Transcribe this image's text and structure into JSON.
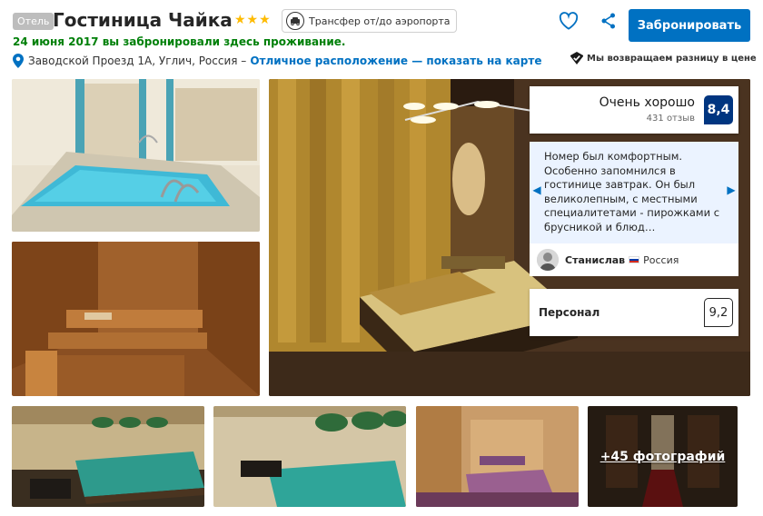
{
  "header": {
    "type_badge": "Отель",
    "hotel_name": "Гостиница Чайка",
    "stars": "★★★",
    "transfer_label": "Трансфер от/до аэропорта",
    "booked_note": "24 июня 2017 вы забронировали здесь проживание.",
    "address": "Заводской Проезд 1А, Углич, Россия –",
    "map_link": "Отличное расположение — показать на карте",
    "book_button": "Забронировать",
    "price_guarantee": "Мы возвращаем разницу в цене"
  },
  "rating": {
    "word": "Очень хорошо",
    "count": "431 отзыв",
    "score": "8,4"
  },
  "review": {
    "text": "Номер был комфортным. Особенно запомнился в гостинице завтрак. Он был великолепным, с местными специалитетами - пирожками с брусникой и блюд…",
    "reviewer": "Станислав",
    "country": "Россия"
  },
  "staff": {
    "label": "Персонал",
    "score": "9,2"
  },
  "gallery": {
    "more_photos": "+45 фотографий"
  },
  "colors": {
    "brand_blue": "#0071c2",
    "dark_blue": "#003580",
    "green": "#008009",
    "star": "#febb02"
  },
  "icons": {
    "favorite": "heart-icon",
    "share": "share-icon",
    "location": "pin-icon",
    "transfer": "transfer-icon",
    "guarantee": "checkmark-shield-icon"
  }
}
